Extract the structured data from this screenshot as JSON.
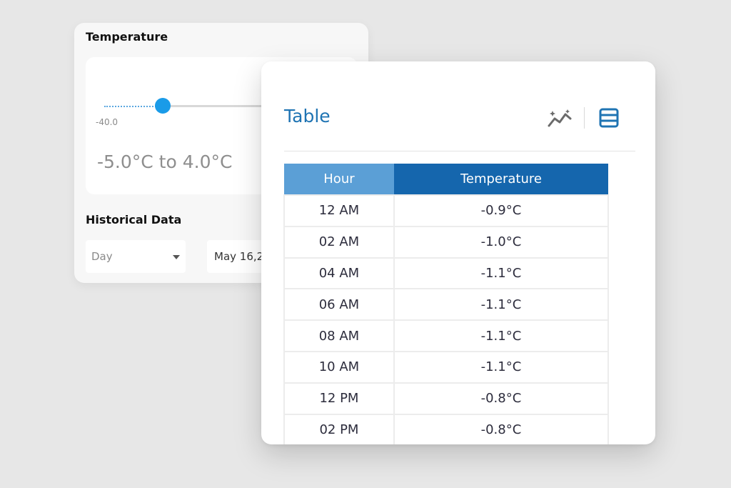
{
  "temperature_card": {
    "title": "Temperature",
    "slider_min_label": "-40.0",
    "range_label": "-5.0°C to 4.0°C",
    "historical_title": "Historical Data",
    "period_select_value": "Day",
    "date_value": "May 16,2"
  },
  "table_card": {
    "title": "Table",
    "columns": [
      "Hour",
      "Temperature"
    ],
    "rows": [
      [
        "12 AM",
        "-0.9°C"
      ],
      [
        "02 AM",
        "-1.0°C"
      ],
      [
        "04 AM",
        "-1.1°C"
      ],
      [
        "06 AM",
        "-1.1°C"
      ],
      [
        "08 AM",
        "-1.1°C"
      ],
      [
        "10 AM",
        "-1.1°C"
      ],
      [
        "12 PM",
        "-0.8°C"
      ],
      [
        "02 PM",
        "-0.8°C"
      ]
    ]
  },
  "icons": {
    "chart_view": "line-chart-icon",
    "table_view": "table-icon"
  },
  "colors": {
    "accent_blue": "#1f74b3",
    "header_hour_bg": "#5b9fd6",
    "header_temp_bg": "#1566ad",
    "slider_thumb": "#1a9be8"
  }
}
